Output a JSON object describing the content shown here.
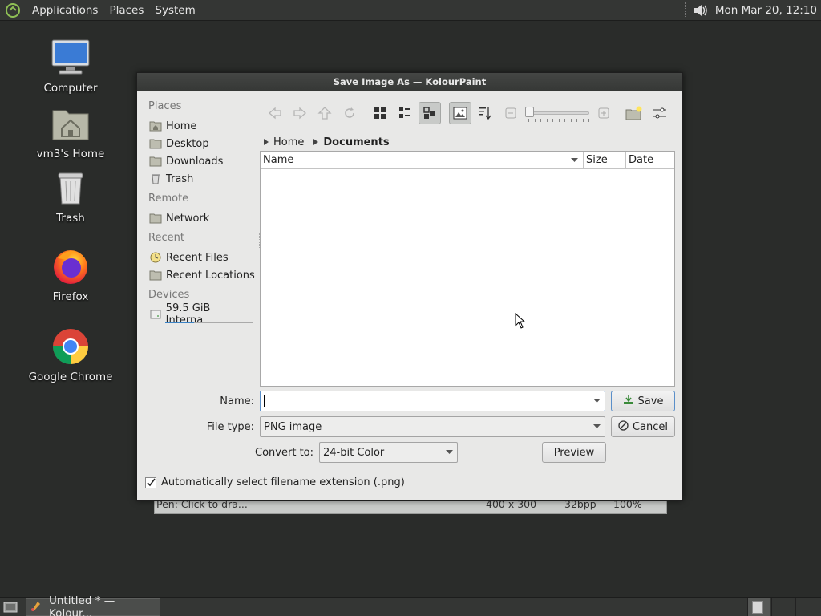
{
  "top_panel": {
    "menu": [
      "Applications",
      "Places",
      "System"
    ],
    "clock": "Mon Mar 20, 12:10"
  },
  "desktop_icons": [
    {
      "label": "Computer",
      "icon": "computer-icon"
    },
    {
      "label": "vm3's Home",
      "icon": "home-folder-icon"
    },
    {
      "label": "Trash",
      "icon": "trash-icon"
    },
    {
      "label": "Firefox",
      "icon": "firefox-icon"
    },
    {
      "label": "Google Chrome",
      "icon": "chrome-icon"
    }
  ],
  "background_window": {
    "status_text": "Pen: Click to dra...",
    "dimensions": "400 x 300",
    "depth": "32bpp",
    "zoom": "100%"
  },
  "dialog": {
    "title": "Save Image As — KolourPaint",
    "places": {
      "places_header": "Places",
      "places_items": [
        "Home",
        "Desktop",
        "Downloads",
        "Trash"
      ],
      "remote_header": "Remote",
      "remote_items": [
        "Network"
      ],
      "recent_header": "Recent",
      "recent_items": [
        "Recent Files",
        "Recent Locations"
      ],
      "devices_header": "Devices",
      "device_item": "59.5 GiB Interna...",
      "device_usage_fraction": 0.33
    },
    "breadcrumb": [
      "Home",
      "Documents"
    ],
    "columns": {
      "name": "Name",
      "size": "Size",
      "date": "Date"
    },
    "zoom_slider_fraction": 0.0,
    "name_label": "Name:",
    "name_value": "",
    "filetype_label": "File type:",
    "filetype_value": "PNG image",
    "convert_label": "Convert to:",
    "convert_value": "24-bit Color",
    "save_button": "Save",
    "cancel_button": "Cancel",
    "preview_button": "Preview",
    "auto_ext_label": "Automatically select filename extension (.png)",
    "auto_ext_checked": true
  },
  "taskbar": {
    "task_label": "Untitled * — Kolour..."
  },
  "colors": {
    "panel": "#343634",
    "desktop": "#2a2c2a",
    "dialog_bg": "#e8e8e7",
    "accent": "#5a8fc9"
  }
}
